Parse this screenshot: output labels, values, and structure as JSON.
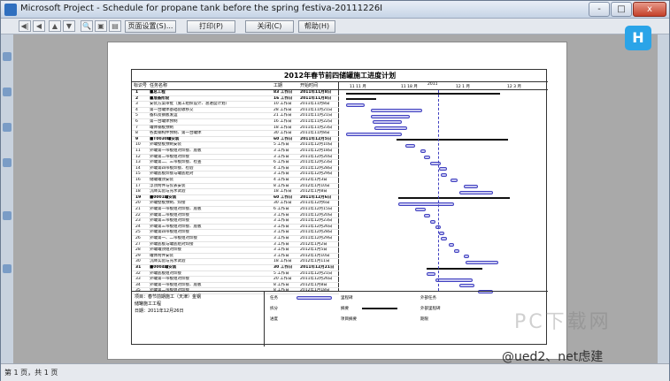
{
  "window": {
    "title": "Microsoft Project - Schedule for propane tank before the spring festiva-20111226I"
  },
  "window_controls": {
    "minimize": "-",
    "maximize": "□",
    "close": "x"
  },
  "toolbar": {
    "nav_icons": [
      "◀|",
      "◀",
      "▲",
      "▼"
    ],
    "zoom_icons": [
      "🔍",
      "▣",
      "▤"
    ],
    "buttons": [
      "页面设置(S)...",
      "打印(P)",
      "关闭(C)",
      "帮助(H)"
    ]
  },
  "floating_button": "H",
  "sheet": {
    "title": "2012年春节前四储罐施工进度计划",
    "columns": [
      "标识号",
      "任务名称",
      "工期",
      "开始时间"
    ],
    "timescale": [
      "11 11 月",
      "11 18 月",
      "2011",
      "12 1 月",
      "12 3 月"
    ],
    "rows": [
      {
        "id": "1",
        "name": "■总工程",
        "dur": "83 工作日",
        "start": "2011年11月8日"
      },
      {
        "id": "2",
        "name": "■准备阶段",
        "dur": "16 工作日",
        "start": "2011年11月8日"
      },
      {
        "id": "3",
        "name": "安装方案审批（施工组织设计、总进度计划）",
        "dur": "10 工作日",
        "start": "2011年11月8日"
      },
      {
        "id": "4",
        "name": "第一台罐体基础验收移交",
        "dur": "28 工作日",
        "start": "2011年11月21日"
      },
      {
        "id": "5",
        "name": "备料及钢板发运",
        "dur": "21 工作日",
        "start": "2011年11月21日"
      },
      {
        "id": "6",
        "name": "第一台罐体预制",
        "dur": "16 工作日",
        "start": "2011年11月22日"
      },
      {
        "id": "7",
        "name": "罐体钢板预制",
        "dur": "18 工作日",
        "start": "2011年11月23日"
      },
      {
        "id": "8",
        "name": "各类钢构件预制、第一台罐体",
        "dur": "30 工作日",
        "start": "2011年11月8日"
      },
      {
        "id": "9",
        "name": "■T0030罐安装",
        "dur": "60 工作日",
        "start": "2011年12月5日"
      },
      {
        "id": "10",
        "name": "外罐壁板预制安装",
        "dur": "5 工作日",
        "start": "2011年12月10日"
      },
      {
        "id": "11",
        "name": "外罐第一带板组对焊接、底板",
        "dur": "3 工作日",
        "start": "2011年12月18日"
      },
      {
        "id": "12",
        "name": "外罐第二带板组对焊接",
        "dur": "3 工作日",
        "start": "2011年12月20日"
      },
      {
        "id": "13",
        "name": "外罐第二、三带板焊接、检查",
        "dur": "6 工作日",
        "start": "2011年12月23日"
      },
      {
        "id": "14",
        "name": "外罐第四带板焊接、检验",
        "dur": "4 工作日",
        "start": "2011年12月28日"
      },
      {
        "id": "15",
        "name": "外罐底板焊接与罐底组对",
        "dur": "3 工作日",
        "start": "2011年12月29日"
      },
      {
        "id": "16",
        "name": "储罐罐顶安装",
        "dur": "4 工作日",
        "start": "2012年1月3日"
      },
      {
        "id": "17",
        "name": "浮顶附件与仪表安装",
        "dur": "8 工作日",
        "start": "2012年1月10日"
      },
      {
        "id": "18",
        "name": "沉降实验与充水试验",
        "dur": "18 工作日",
        "start": "2012年1月8日"
      },
      {
        "id": "19",
        "name": "■0001罐安装",
        "dur": "60 工作日",
        "start": "2011年12月6日"
      },
      {
        "id": "20",
        "name": "外罐壁板预制、焊接",
        "dur": "30 工作日",
        "start": "2011年12月6日"
      },
      {
        "id": "21",
        "name": "外罐第一带板组对焊接、底板",
        "dur": "6 工作日",
        "start": "2011年12月15日"
      },
      {
        "id": "22",
        "name": "外罐第二带板组对焊接",
        "dur": "3 工作日",
        "start": "2011年12月20日"
      },
      {
        "id": "23",
        "name": "外罐第三带板组对焊接",
        "dur": "3 工作日",
        "start": "2011年12月23日"
      },
      {
        "id": "24",
        "name": "外罐第三带板组对焊接、底板",
        "dur": "3 工作日",
        "start": "2011年12月26日"
      },
      {
        "id": "25",
        "name": "外罐第四带板组对焊接",
        "dur": "3 工作日",
        "start": "2011年12月28日"
      },
      {
        "id": "26",
        "name": "外罐第一、二带板组对焊接",
        "dur": "3 工作日",
        "start": "2011年12月29日"
      },
      {
        "id": "27",
        "name": "外罐底板与罐底组对焊接",
        "dur": "3 工作日",
        "start": "2012年1月2日"
      },
      {
        "id": "28",
        "name": "外罐罐顶组对焊接",
        "dur": "3 工作日",
        "start": "2012年1月5日"
      },
      {
        "id": "29",
        "name": "罐体附件安装",
        "dur": "3 工作日",
        "start": "2012年1月10日"
      },
      {
        "id": "30",
        "name": "沉降实验与充水试验",
        "dur": "18 工作日",
        "start": "2012年1月11日"
      },
      {
        "id": "31",
        "name": "■0004罐安装",
        "dur": "30 工作日",
        "start": "2011年12月21日"
      },
      {
        "id": "32",
        "name": "外罐底板组对焊接",
        "dur": "5 工作日",
        "start": "2011年12月21日"
      },
      {
        "id": "33",
        "name": "外罐第一带板组对焊接",
        "dur": "20 工作日",
        "start": "2011年12月26日"
      },
      {
        "id": "34",
        "name": "外罐第一带板组对焊接、底板",
        "dur": "8 工作日",
        "start": "2012年1月8日"
      },
      {
        "id": "35",
        "name": "外罐第二带板组对焊接",
        "dur": "8 工作日",
        "start": "2012年1月18日"
      }
    ],
    "legend_info": [
      "项目：春节前期施工（天津）金钢",
      "储罐施工工程",
      "日期：2011年12月26日"
    ],
    "legend": [
      {
        "label": "任务"
      },
      {
        "label": "里程碑"
      },
      {
        "label": "外部任务"
      },
      {
        "label": "拆分"
      },
      {
        "label": "摘要"
      },
      {
        "label": "外部里程碑"
      },
      {
        "label": "进度"
      },
      {
        "label": "项目摘要"
      },
      {
        "label": "期限"
      }
    ]
  },
  "status": "第 1 页，共 1 页",
  "watermark": "PC下载网",
  "watermark_credit": "@ued2、net虑建"
}
